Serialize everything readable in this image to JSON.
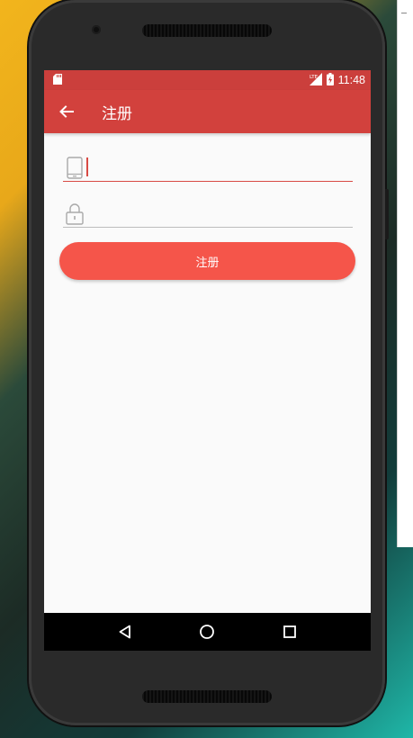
{
  "status_bar": {
    "time": "11:48",
    "network_label": "LTE",
    "icons": [
      "sd-card-icon",
      "lte-signal-icon",
      "battery-charging-icon"
    ]
  },
  "toolbar": {
    "title": "注册",
    "back_icon": "arrow-back-icon"
  },
  "form": {
    "phone_field": {
      "value": "",
      "placeholder": "",
      "icon": "phone-icon",
      "focused": true
    },
    "password_field": {
      "value": "",
      "placeholder": "",
      "icon": "lock-icon"
    },
    "submit_label": "注册"
  },
  "nav_bar": {
    "icons": [
      "nav-back-icon",
      "nav-home-icon",
      "nav-recents-icon"
    ]
  },
  "colors": {
    "status_bar": "#cb3f3c",
    "toolbar": "#d2413d",
    "accent": "#d84a44",
    "button": "#f5554a",
    "screen_bg": "#fafafa"
  }
}
